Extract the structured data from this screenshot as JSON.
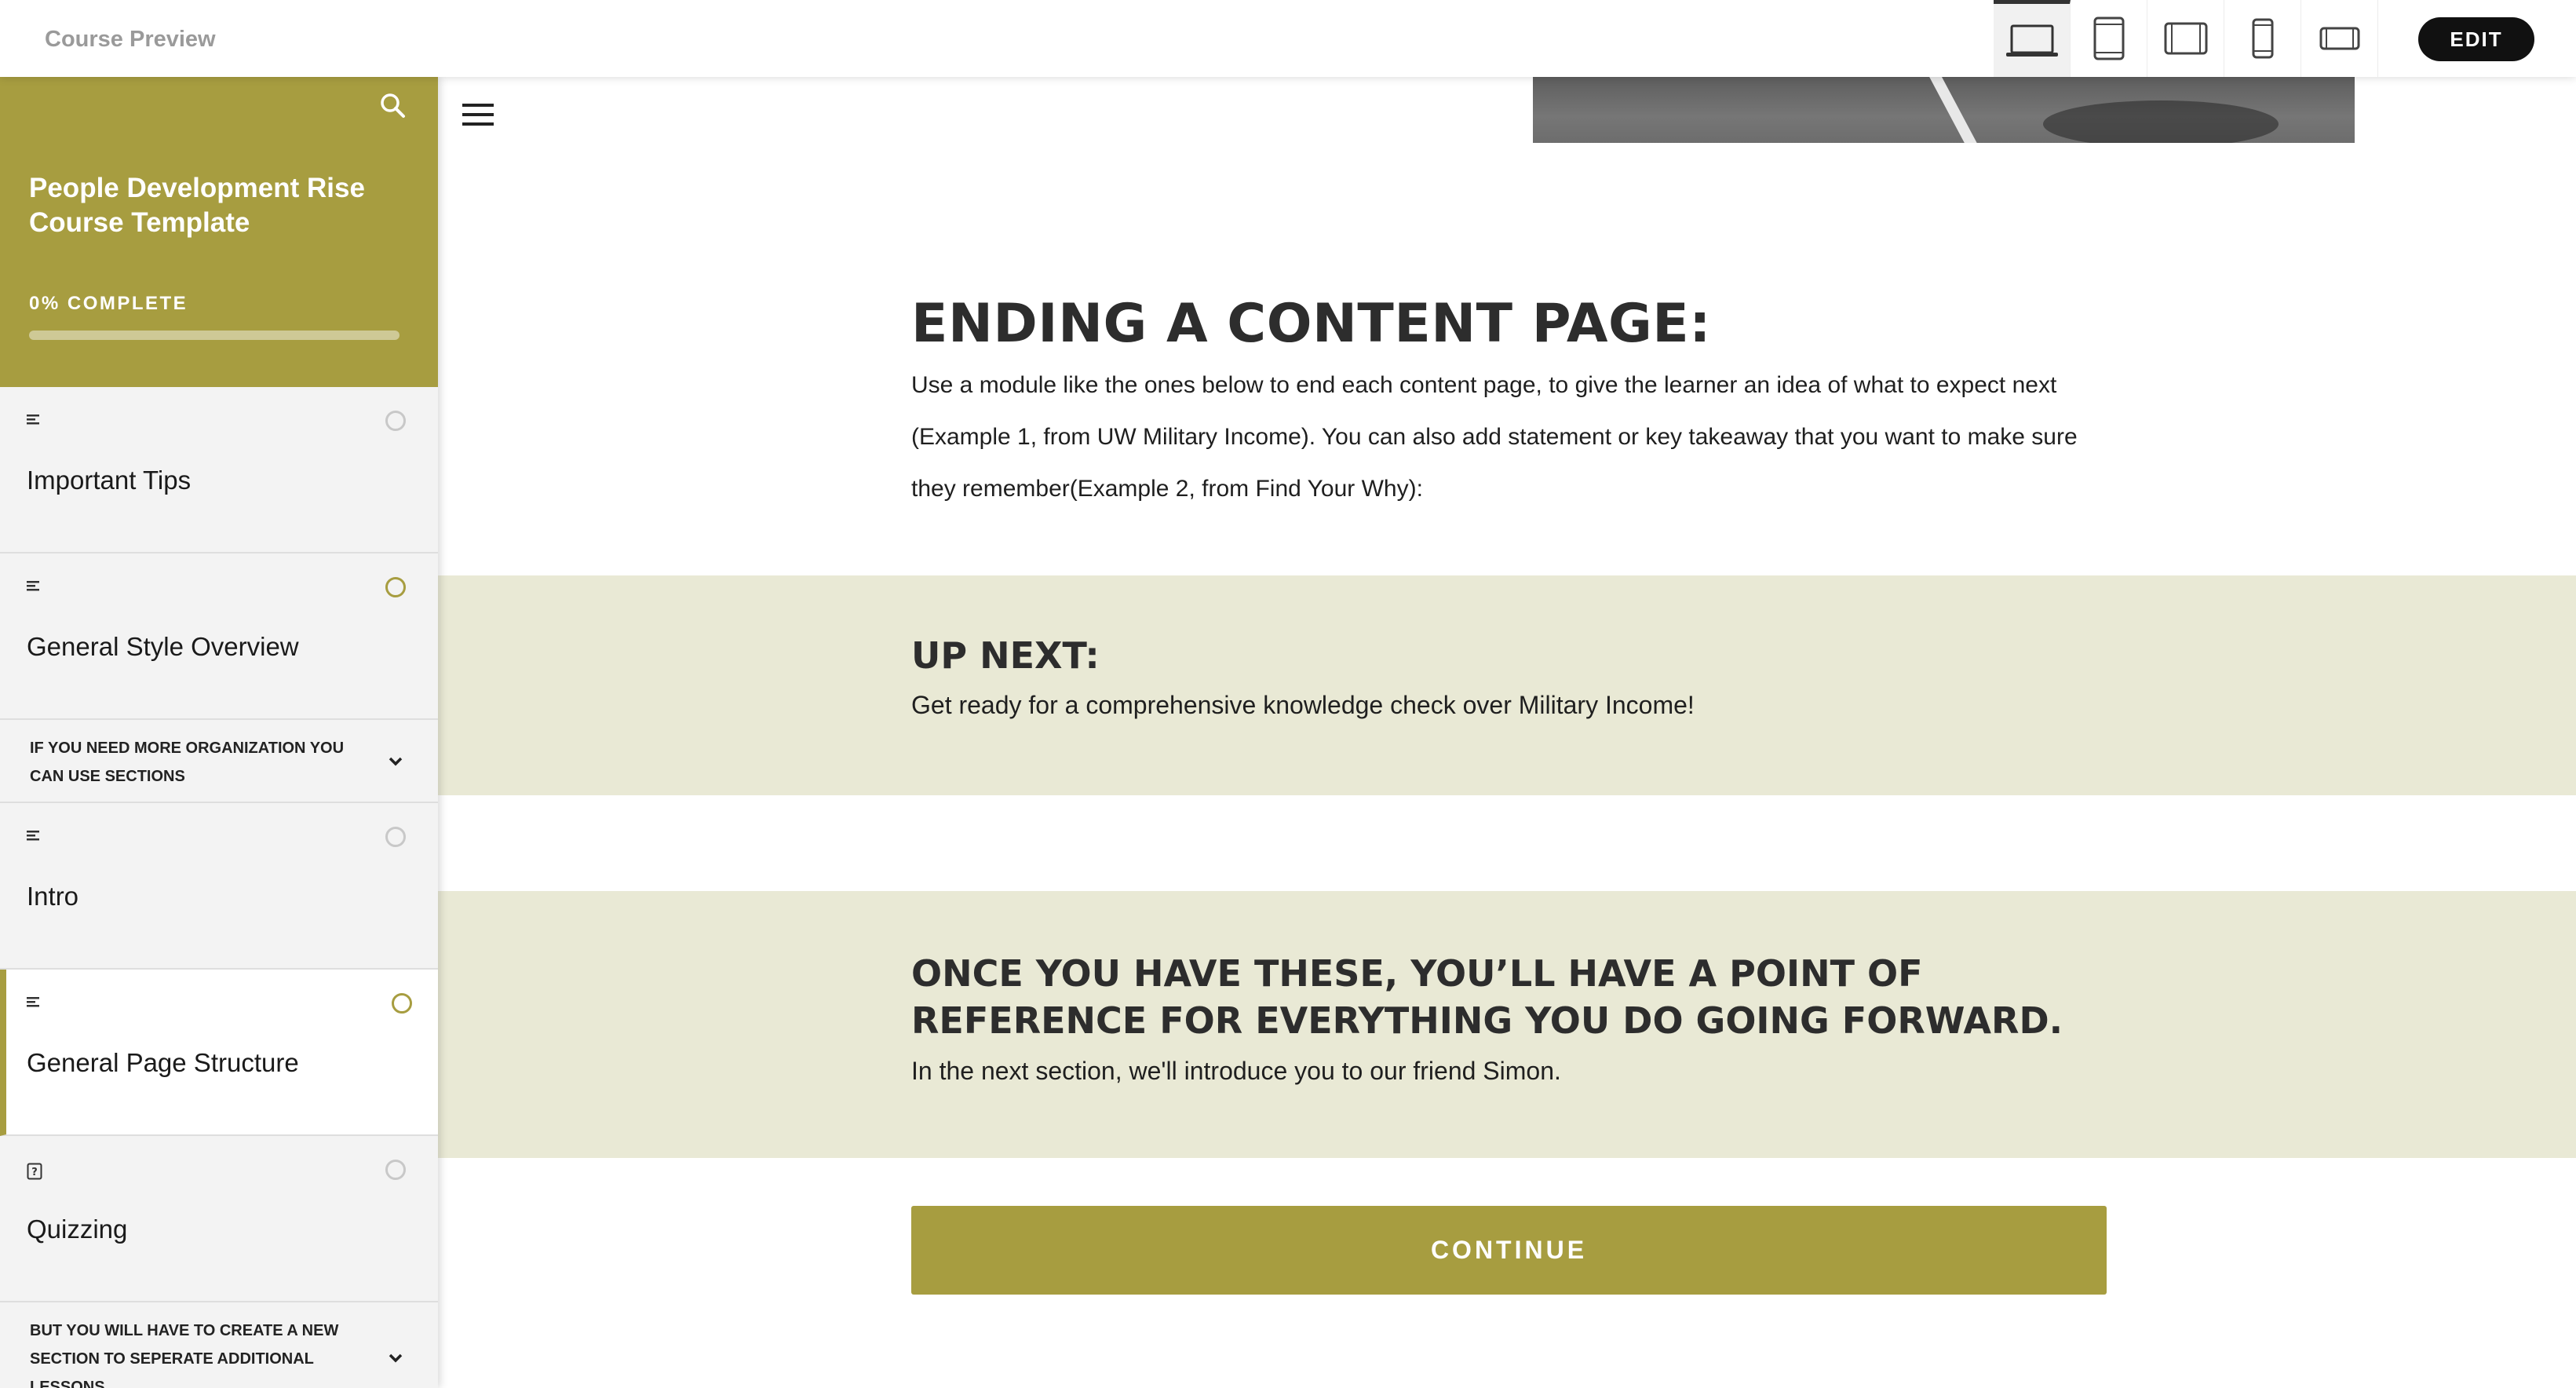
{
  "topbar": {
    "title": "Course Preview",
    "devices": [
      {
        "name": "laptop-icon",
        "active": true
      },
      {
        "name": "tablet-portrait-icon",
        "active": false
      },
      {
        "name": "tablet-landscape-icon",
        "active": false
      },
      {
        "name": "phone-portrait-icon",
        "active": false
      },
      {
        "name": "phone-landscape-icon",
        "active": false
      }
    ],
    "edit_label": "EDIT"
  },
  "sidebar": {
    "course_title": "People Development Rise Course Template",
    "progress_label": "0% COMPLETE",
    "progress_fraction": 0,
    "items": [
      {
        "kind": "lesson",
        "label": "Important Tips",
        "icon": "text-lesson-icon",
        "status": "not-started"
      },
      {
        "kind": "lesson",
        "label": "General Style Overview",
        "icon": "text-lesson-icon",
        "status": "in-progress"
      },
      {
        "kind": "section",
        "label": "IF YOU NEED MORE ORGANIZATION YOU CAN USE SECTIONS"
      },
      {
        "kind": "lesson",
        "label": "Intro",
        "icon": "text-lesson-icon",
        "status": "not-started"
      },
      {
        "kind": "lesson",
        "label": "General Page Structure",
        "icon": "text-lesson-icon",
        "status": "in-progress",
        "active": true
      },
      {
        "kind": "lesson",
        "label": "Quizzing",
        "icon": "quiz-lesson-icon",
        "status": "not-started"
      },
      {
        "kind": "section",
        "label": "BUT YOU WILL HAVE TO CREATE A NEW SECTION TO SEPERATE ADDITIONAL LESSONS"
      }
    ]
  },
  "main": {
    "ending": {
      "heading": "ENDING A CONTENT PAGE:",
      "body": "Use a module like the ones below to end each content page, to give the learner an idea of what to expect next (Example 1, from UW Military Income). You can also add statement or key takeaway that you want to make sure they remember(Example 2, from Find Your Why):"
    },
    "up_next": {
      "heading": "UP NEXT:",
      "body": "Get ready for a comprehensive knowledge check over Military Income!"
    },
    "reference": {
      "heading": "ONCE YOU HAVE THESE, YOU’LL HAVE A POINT OF REFERENCE FOR EVERYTHING YOU DO GOING FORWARD.",
      "body": "In the next section, we'll introduce you to our friend Simon."
    },
    "continue_label": "CONTINUE"
  },
  "colors": {
    "accent": "#a79d40",
    "band": "#e9e9d5",
    "heading": "#2d2d2d"
  }
}
